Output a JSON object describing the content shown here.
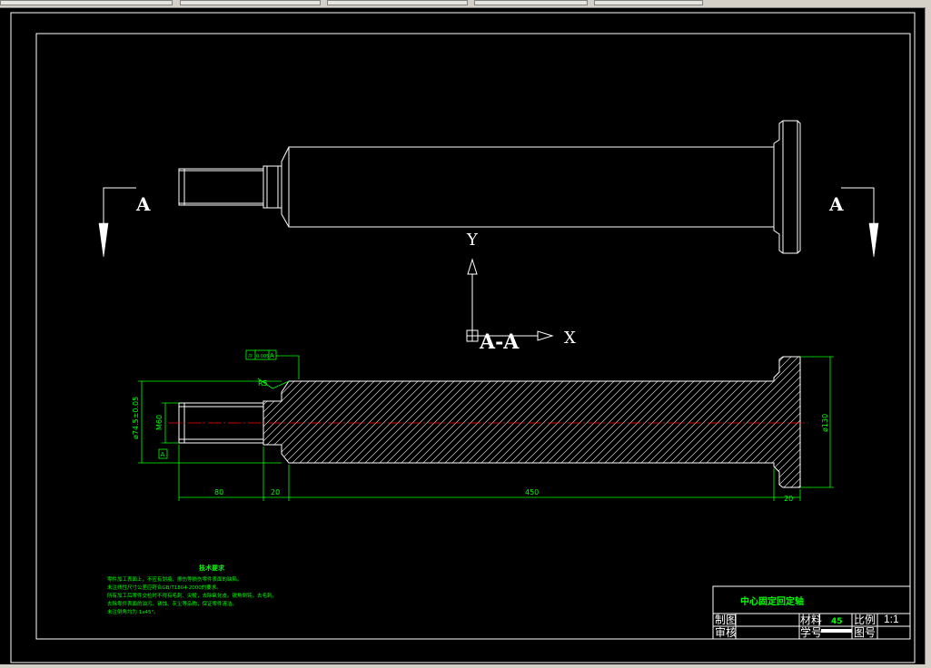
{
  "drawing": {
    "section_labels": {
      "left_A": "A",
      "right_A": "A",
      "section_title": "A-A"
    },
    "ucs": {
      "y_axis": "Y",
      "x_axis": "X"
    },
    "dimensions": {
      "radius": "R5",
      "dia_thread": "M60",
      "dia_body": "ø74.5±0.05",
      "dia_flange": "ø130",
      "len_thread": "80",
      "len_neck": "20",
      "len_body": "450",
      "len_flange": "20"
    },
    "tolerance": {
      "symbol": "⌭",
      "value": "0.005",
      "datum": "A",
      "datum_flag": "A"
    },
    "tech_requirements": {
      "title": "技术要求",
      "lines": [
        "零件加工表面上，不应有划痕、擦伤等损伤零件表面的缺陷。",
        "未注线性尺寸公差应符合GB/T1804-2000的要求。",
        "所有加工后零件交检时不得有毛刺、尖棱，去除氧化皮。锐角倒钝，去毛刺。",
        "去除零件表面的油污、锈蚀、灰尘等杂物，保证零件清洁。",
        "未注倒角均为 1x45°。"
      ]
    },
    "title_block": {
      "part_name": "中心固定回定轴",
      "material_label": "材料",
      "material_value": "45",
      "scale_label": "比例",
      "scale_value": "1:1",
      "drawn_label": "制图",
      "check_label": "审核",
      "student_label": "学号",
      "drawing_no_label": "图号"
    }
  },
  "colors": {
    "background": "#000000",
    "geometry": "#ffffff",
    "annotation": "#00ff00",
    "centerline": "#ff0000"
  }
}
